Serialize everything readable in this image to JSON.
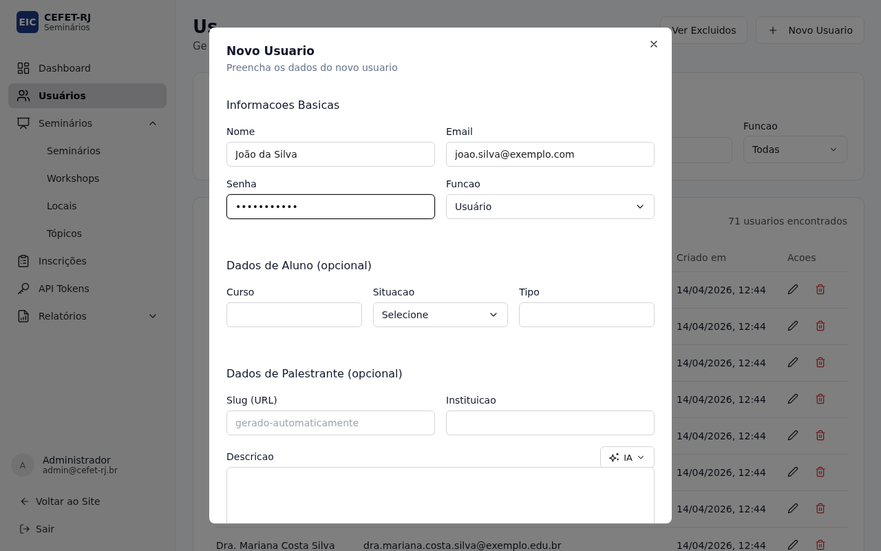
{
  "sidebar": {
    "logo": "EIC",
    "name": "CEFET-RJ",
    "subtitle": "Seminários",
    "items": [
      {
        "label": "Dashboard",
        "selected": false
      },
      {
        "label": "Usuários",
        "selected": true
      },
      {
        "label": "Seminários",
        "selected": false,
        "expanded": true,
        "children": [
          {
            "label": "Seminários"
          },
          {
            "label": "Workshops"
          },
          {
            "label": "Locais"
          },
          {
            "label": "Tópicos"
          }
        ]
      },
      {
        "label": "Inscrições",
        "selected": false
      },
      {
        "label": "API Tokens",
        "selected": false
      },
      {
        "label": "Relatórios",
        "selected": false,
        "expanded": false
      }
    ],
    "user": {
      "initial": "A",
      "name": "Administrador",
      "email": "admin@cefet-rj.br"
    },
    "links": [
      {
        "label": "Voltar ao Site"
      },
      {
        "label": "Sair"
      }
    ]
  },
  "main": {
    "title": "Us",
    "subtitle": "Ge",
    "actions": [
      {
        "label": "Ver Excluidos"
      },
      {
        "label": "Novo Usuario"
      }
    ],
    "filters": {
      "role_label": "Funcao",
      "role_value": "Todas"
    },
    "table": {
      "count": "71 usuarios encontrados",
      "columns": [
        "Criado em",
        "Acoes"
      ],
      "rows": [
        {
          "created": "14/04/2026, 12:44"
        },
        {
          "created": "14/04/2026, 12:44"
        },
        {
          "created": "14/04/2026, 12:44"
        },
        {
          "created": "14/04/2026, 12:44"
        },
        {
          "created": "14/04/2026, 12:44"
        },
        {
          "created": "14/04/2026, 12:44"
        },
        {
          "created": "14/04/2026, 12:44"
        },
        {
          "name": "Dra. Mariana Costa Silva",
          "email": "dra.mariana.costa.silva@exemplo.edu.br",
          "created": "14/04/2026, 12:44"
        }
      ]
    }
  },
  "modal": {
    "title": "Novo Usuario",
    "subtitle": "Preencha os dados do novo usuario",
    "sections": [
      {
        "title": "Informacoes Basicas",
        "fields": [
          {
            "label": "Nome",
            "kind": "text",
            "value": "João da Silva",
            "focused": false
          },
          {
            "label": "Email",
            "kind": "text",
            "value": "joao.silva@exemplo.com",
            "focused": false
          },
          {
            "label": "Senha",
            "kind": "password",
            "value": "•••••••••••",
            "focused": true
          },
          {
            "label": "Funcao",
            "kind": "select",
            "value": "Usuário",
            "focused": false
          }
        ]
      },
      {
        "title": "Dados de Aluno (opcional)",
        "fields": [
          {
            "label": "Curso",
            "kind": "text",
            "focused": false
          },
          {
            "label": "Situacao",
            "kind": "select",
            "value": "Selecione",
            "focused": false
          },
          {
            "label": "Tipo",
            "kind": "text",
            "focused": false
          }
        ]
      },
      {
        "title": "Dados de Palestrante (opcional)",
        "fields": [
          {
            "label": "Slug (URL)",
            "kind": "text",
            "placeholder": "gerado-automaticamente",
            "focused": false
          },
          {
            "label": "Instituicao",
            "kind": "text",
            "focused": false
          },
          {
            "label": "Descricao",
            "kind": "textarea",
            "ai_button": "IA",
            "focused": false
          }
        ]
      }
    ]
  }
}
